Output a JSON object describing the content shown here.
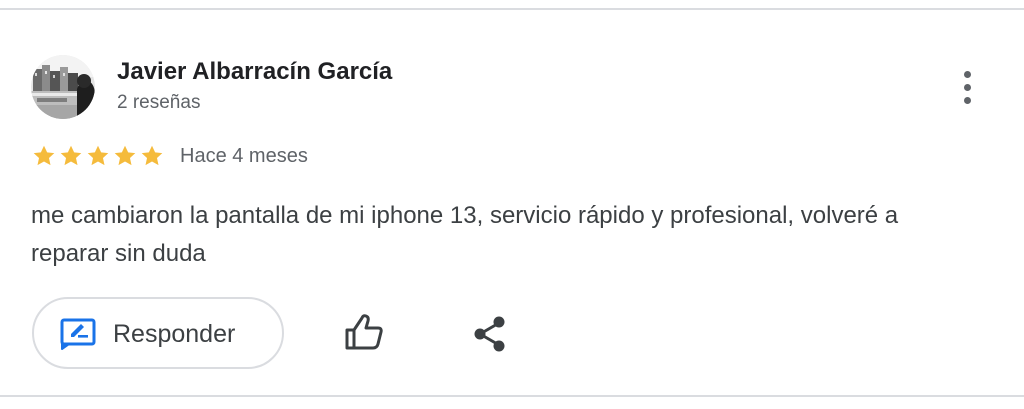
{
  "review": {
    "author_name": "Javier Albarracín García",
    "author_review_count": "2 reseñas",
    "rating": 5,
    "rating_max": 5,
    "date": "Hace 4 meses",
    "text": "me cambiaron la pantalla de mi iphone 13, servicio rápido y profesional, volveré a reparar sin duda"
  },
  "actions": {
    "reply_label": "Responder",
    "reply_icon": "reply-edit-icon",
    "like_icon": "thumbs-up-icon",
    "share_icon": "share-icon",
    "more_icon": "more-vertical-icon"
  },
  "colors": {
    "star": "#f5bb3c",
    "reply_icon": "#1a73e8",
    "text_primary": "#202124",
    "text_secondary": "#5f6368"
  }
}
